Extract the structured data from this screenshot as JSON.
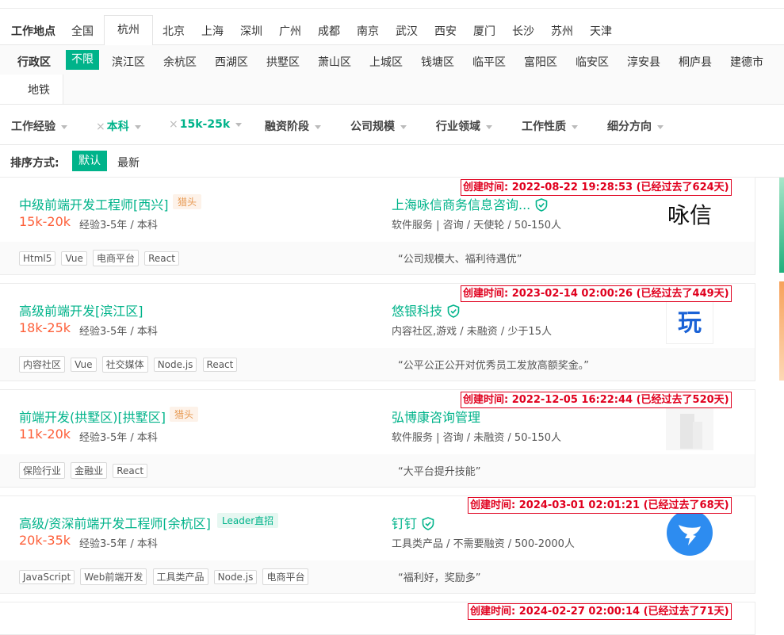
{
  "location": {
    "label": "工作地点",
    "cities": [
      "全国",
      "杭州",
      "北京",
      "上海",
      "深圳",
      "广州",
      "成都",
      "南京",
      "武汉",
      "西安",
      "厦门",
      "长沙",
      "苏州",
      "天津"
    ],
    "selected": "杭州"
  },
  "district": {
    "label": "行政区",
    "items": [
      "不限",
      "滨江区",
      "余杭区",
      "西湖区",
      "拱墅区",
      "萧山区",
      "上城区",
      "钱塘区",
      "临平区",
      "富阳区",
      "临安区",
      "淳安县",
      "桐庐县",
      "建德市"
    ],
    "selected": "不限",
    "subway": "地铁"
  },
  "filters": [
    {
      "label": "工作经验",
      "active": false
    },
    {
      "label": "本科",
      "active": true
    },
    {
      "label": "15k-25k",
      "active": true
    },
    {
      "label": "融资阶段",
      "active": false
    },
    {
      "label": "公司规模",
      "active": false
    },
    {
      "label": "行业领域",
      "active": false
    },
    {
      "label": "工作性质",
      "active": false
    },
    {
      "label": "细分方向",
      "active": false
    }
  ],
  "sort": {
    "label": "排序方式:",
    "default": "默认",
    "newest": "最新"
  },
  "jobs": [
    {
      "title": "中级前端开发工程师[西兴]",
      "tag": "猎头",
      "salary": "15k-20k",
      "requirements": "经验3-5年 / 本科",
      "company": "上海咏信商务信息咨询...",
      "verified": true,
      "company_info": "软件服务 | 咨询 / 天使轮 / 50-150人",
      "skills": [
        "Html5",
        "Vue",
        "电商平台",
        "React"
      ],
      "slogan": "“公司规模大、福利待遇优”",
      "logo_text": "咏信",
      "created": "创建时间: 2022-08-22 19:28:53 (已经过去了624天)"
    },
    {
      "title": "高级前端开发[滨江区]",
      "tag": "",
      "salary": "18k-25k",
      "requirements": "经验3-5年 / 本科",
      "company": "悠银科技",
      "verified": true,
      "company_info": "内容社区,游戏 / 未融资 / 少于15人",
      "skills": [
        "内容社区",
        "Vue",
        "社交媒体",
        "Node.js",
        "React"
      ],
      "slogan": "“公平公正公开对优秀员工发放高额奖金。”",
      "logo_text": "玩",
      "created": "创建时间: 2023-02-14 02:00:26 (已经过去了449天)"
    },
    {
      "title": "前端开发(拱墅区)[拱墅区]",
      "tag": "猎头",
      "salary": "11k-20k",
      "requirements": "经验3-5年 / 本科",
      "company": "弘博康咨询管理",
      "verified": false,
      "company_info": "软件服务 | 咨询 / 未融资 / 50-150人",
      "skills": [
        "保险行业",
        "金融业",
        "React"
      ],
      "slogan": "“大平台提升技能”",
      "logo_text": "",
      "created": "创建时间: 2022-12-05 16:22:44 (已经过去了520天)"
    },
    {
      "title": "高级/资深前端开发工程师[余杭区]",
      "tag": "Leader直招",
      "salary": "20k-35k",
      "requirements": "经验3-5年 / 本科",
      "company": "钉钉",
      "verified": true,
      "company_info": "工具类产品 / 不需要融资 / 500-2000人",
      "skills": [
        "JavaScript",
        "Web前端开发",
        "工具类产品",
        "Node.js",
        "电商平台"
      ],
      "slogan": "“福利好，奖励多”",
      "logo_text": "",
      "created": "创建时间: 2024-03-01 02:01:21 (已经过去了68天)"
    }
  ],
  "partial_created": "创建时间: 2024-02-27 02:00:14 (已经过去了71天)",
  "colors": {
    "accent": "#00b38a",
    "salary": "#fd5f39",
    "created": "#e0001e",
    "hunter_tag": "#e79a54"
  }
}
